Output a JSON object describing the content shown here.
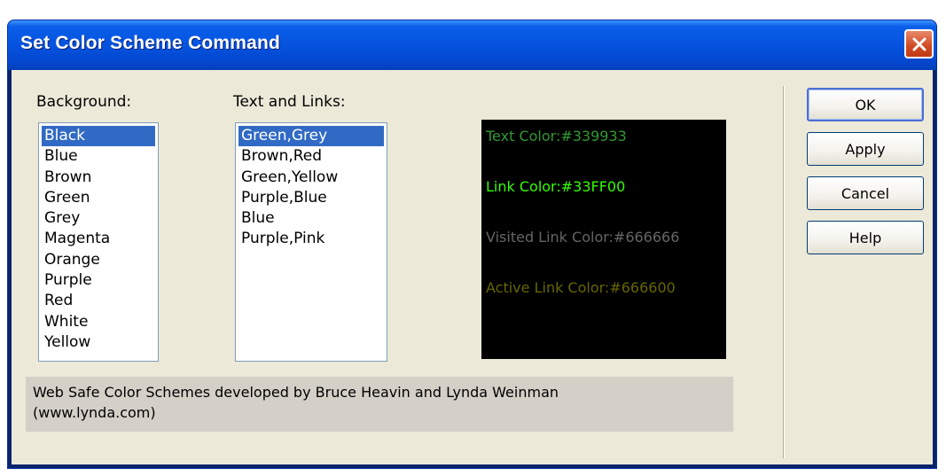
{
  "window": {
    "title": "Set Color Scheme Command"
  },
  "background": {
    "label": "Background:",
    "items": [
      "Black",
      "Blue",
      "Brown",
      "Green",
      "Grey",
      "Magenta",
      "Orange",
      "Purple",
      "Red",
      "White",
      "Yellow"
    ],
    "selected_index": 0
  },
  "text_links": {
    "label": "Text and Links:",
    "items": [
      "Green,Grey",
      "Brown,Red",
      "Green,Yellow",
      "Purple,Blue",
      "Blue",
      "Purple,Pink"
    ],
    "selected_index": 0
  },
  "preview": {
    "background_color": "#000000",
    "lines": [
      {
        "text": "Text Color:#339933",
        "color": "#339933"
      },
      {
        "text": "Link Color:#33FF00",
        "color": "#33FF00"
      },
      {
        "text": "Visited Link Color:#666666",
        "color": "#666666"
      },
      {
        "text": "Active Link Color:#666600",
        "color": "#666600"
      }
    ]
  },
  "credits": {
    "line1": "Web Safe Color Schemes developed by Bruce Heavin and Lynda Weinman",
    "line2": "(www.lynda.com)"
  },
  "buttons": {
    "ok": "OK",
    "apply": "Apply",
    "cancel": "Cancel",
    "help": "Help"
  },
  "colors": {
    "title_bar": "#0553e0",
    "selection": "#316ac5",
    "dialog_face": "#ece9d8",
    "close_button": "#d14a22"
  },
  "icons": {
    "close": "close-icon"
  }
}
